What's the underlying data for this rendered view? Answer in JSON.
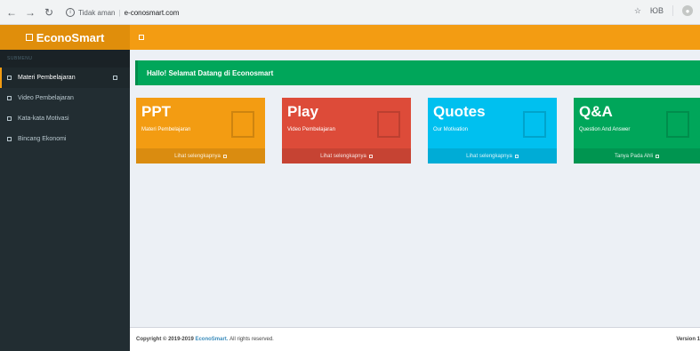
{
  "browser": {
    "security_text": "Tidak aman",
    "url": "e-conosmart.com",
    "ext_label": "ЮВ"
  },
  "app": {
    "brand": "EconoSmart"
  },
  "sidebar": {
    "header": "SUBMENU",
    "items": [
      {
        "label": "Materi Pembelajaran"
      },
      {
        "label": "Video Pembelajaran"
      },
      {
        "label": "Kata-kata Motivasi"
      },
      {
        "label": "Bincang Ekonomi"
      }
    ]
  },
  "main": {
    "welcome": "Hallo! Selamat Datang di Econosmart",
    "boxes": [
      {
        "title": "PPT",
        "subtitle": "Materi Pembelajaran",
        "footer": "Lihat selengkapnya"
      },
      {
        "title": "Play",
        "subtitle": "Video Pembelajaran",
        "footer": "Lihat selengkapnya"
      },
      {
        "title": "Quotes",
        "subtitle": "Our Motivation",
        "footer": "Lihat selengkapnya"
      },
      {
        "title": "Q&A",
        "subtitle": "Question And Answer",
        "footer": "Tanya Pada Ahli"
      }
    ]
  },
  "footer": {
    "copyright": "Copyright © 2019-2019",
    "brand_link": "EconoSmart.",
    "rights": "All rights reserved.",
    "version": "Version 1"
  },
  "colors": {
    "brand": "#e08e0b",
    "topbar": "#f39c12",
    "sidebar": "#222d32",
    "callout": "#00a65a",
    "ppt": "#f39c12",
    "play": "#dd4b39",
    "quotes": "#00c0ef",
    "qa": "#00a65a"
  }
}
